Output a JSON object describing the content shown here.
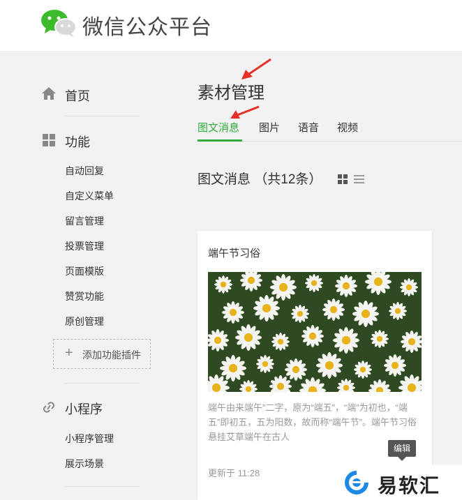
{
  "header": {
    "brand": "微信公众平台"
  },
  "sidebar": {
    "home": "首页",
    "features": {
      "label": "功能",
      "items": [
        "自动回复",
        "自定义菜单",
        "留言管理",
        "投票管理",
        "页面模版",
        "赞赏功能",
        "原创管理"
      ],
      "add_plugin": "添加功能插件"
    },
    "miniprogram": {
      "label": "小程序",
      "items": [
        "小程序管理",
        "展示场景"
      ]
    }
  },
  "main": {
    "title": "素材管理",
    "tabs": [
      "图文消息",
      "图片",
      "语音",
      "视频"
    ],
    "active_tab": "图文消息",
    "count_text": "图文消息 （共12条）",
    "card": {
      "title": "端午节习俗",
      "description": "端午由来端午”二字，原为“端五”，“端”为初也，“端五”即初五，五为阳数，故而称“端午节”。端午节习俗悬挂艾草端午在古人",
      "updated": "更新于 11:28",
      "tooltip": "编辑"
    }
  },
  "watermark": {
    "text": "易软汇"
  },
  "colors": {
    "accent": "#2dae3b",
    "annotation_arrow": "#e8302a"
  }
}
